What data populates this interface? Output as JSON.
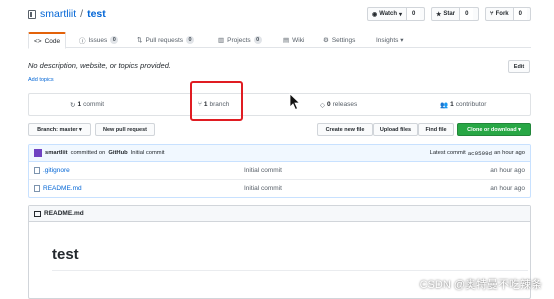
{
  "repo": {
    "owner": "smartliit",
    "separator": "/",
    "name": "test"
  },
  "actions": {
    "watch": {
      "label": "Watch",
      "caret": "▾",
      "count": "0"
    },
    "star": {
      "label": "Star",
      "count": "0"
    },
    "fork": {
      "label": "Fork",
      "count": "0"
    }
  },
  "tabs": [
    {
      "label": "Code",
      "icon": "code-icon"
    },
    {
      "label": "Issues",
      "count": "0",
      "icon": "issue-icon"
    },
    {
      "label": "Pull requests",
      "count": "0",
      "icon": "pull-request-icon"
    },
    {
      "label": "Projects",
      "count": "0",
      "icon": "project-icon"
    },
    {
      "label": "Wiki",
      "icon": "book-icon"
    },
    {
      "label": "Settings",
      "icon": "gear-icon"
    },
    {
      "label": "Insights ▾"
    }
  ],
  "description": "No description, website, or topics provided.",
  "add_topics": "Add topics",
  "edit": "Edit",
  "summary": {
    "commits": {
      "count": "1",
      "label": "commit"
    },
    "branches": {
      "count": "1",
      "label": "branch"
    },
    "releases": {
      "count": "0",
      "label": "releases"
    },
    "contributors": {
      "count": "1",
      "label": "contributor"
    }
  },
  "toolbar": {
    "branch": "Branch: master ▾",
    "new_pr": "New pull request",
    "create": "Create new file",
    "upload": "Upload files",
    "find": "Find file",
    "clone": "Clone or download ▾"
  },
  "commit": {
    "author": "smartliit",
    "text": "committed on",
    "via": "GitHub",
    "message": "Initial commit",
    "latest_label": "Latest commit",
    "sha": "ac0599d",
    "time": "an hour ago"
  },
  "files": [
    {
      "name": ".gitignore",
      "message": "Initial commit",
      "age": "an hour ago"
    },
    {
      "name": "README.md",
      "message": "Initial commit",
      "age": "an hour ago"
    }
  ],
  "readme": {
    "header": "README.md",
    "heading": "test"
  },
  "watermark": "CSDN @奥特曼不吃辣条",
  "colors": {
    "link": "#0366d6",
    "highlight": "#e01c22",
    "clone_button": "#28a745",
    "tab_accent": "#e36209"
  }
}
